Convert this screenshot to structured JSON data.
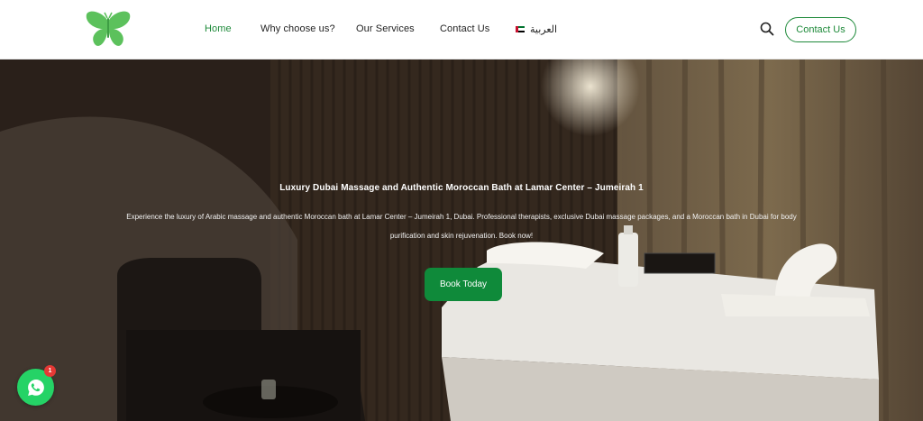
{
  "colors": {
    "brand_green": "#1e8a3a",
    "book_button": "#0f8a3a",
    "whatsapp": "#25d366",
    "badge_red": "#e53935"
  },
  "header": {
    "logo_icon": "butterfly-logo-icon",
    "nav": {
      "home": "Home",
      "why": "Why choose us?",
      "services": "Our Services",
      "contact": "Contact Us",
      "language": "العربية"
    },
    "search_icon": "search-icon",
    "contact_button": "Contact Us"
  },
  "hero": {
    "title": "Luxury Dubai Massage and Authentic Moroccan Bath at Lamar Center – Jumeirah 1",
    "description": "Experience the luxury of Arabic massage and authentic Moroccan bath at Lamar Center – Jumeirah 1, Dubai. Professional therapists, exclusive Dubai massage packages, and a Moroccan bath in Dubai for body purification and skin rejuvenation. Book now!",
    "button": "Book Today"
  },
  "whatsapp": {
    "icon": "whatsapp-icon",
    "badge_count": "1"
  }
}
